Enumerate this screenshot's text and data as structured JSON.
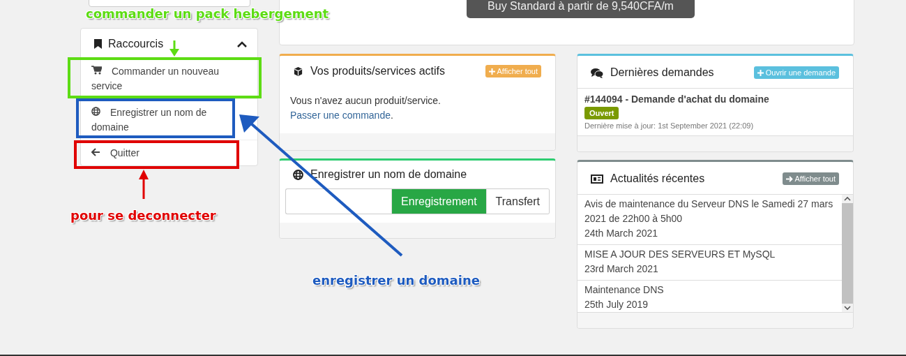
{
  "top_button": {
    "label": "Buy Standard à partir de 9,540CFA/m"
  },
  "shortcuts": {
    "title": "Raccourcis",
    "expanded": true,
    "items": [
      {
        "label": "Commander un nouveau service",
        "kind": "cart"
      },
      {
        "label": "Enregistrer un nom de domaine",
        "kind": "globe"
      },
      {
        "label": "Quitter",
        "kind": "back"
      }
    ]
  },
  "products_panel": {
    "title": "Vos produits/services actifs",
    "button": "Afficher tout",
    "message": "Vous n'avez aucun produit/service.",
    "link": "Passer une commande",
    "after": "."
  },
  "domain_panel": {
    "title": "Enregistrer un nom de domaine",
    "buttons": [
      {
        "label": "Enregistrement",
        "selected": true
      },
      {
        "label": "Transfert",
        "selected": false
      }
    ]
  },
  "requests_panel": {
    "title": "Dernières demandes",
    "button": "Ouvrir une demande",
    "tickets": [
      {
        "title": "#144094 - Demande d'achat du domaine",
        "status": "Ouvert",
        "updated": "Dernière mise à jour: 1st September 2021 (22:09)"
      }
    ]
  },
  "news_panel": {
    "title": "Actualités récentes",
    "button": "Afficher tout",
    "items": [
      {
        "title": "Avis de maintenance du Serveur DNS le Samedi 27 mars 2021 de 22h00 à 5h00",
        "date": "24th March 2021"
      },
      {
        "title": "MISE A JOUR DES SERVEURS ET MySQL",
        "date": "23rd March 2021"
      },
      {
        "title": "Maintenance DNS",
        "date": "25th July 2019"
      }
    ]
  },
  "annotations": [
    {
      "text": "commander un pack hebergement",
      "color": "#5ddc14"
    },
    {
      "text": "pour se deconnecter",
      "color": "#e00000"
    },
    {
      "text": "enregistrer un domaine",
      "color": "#1e5bbf"
    }
  ]
}
